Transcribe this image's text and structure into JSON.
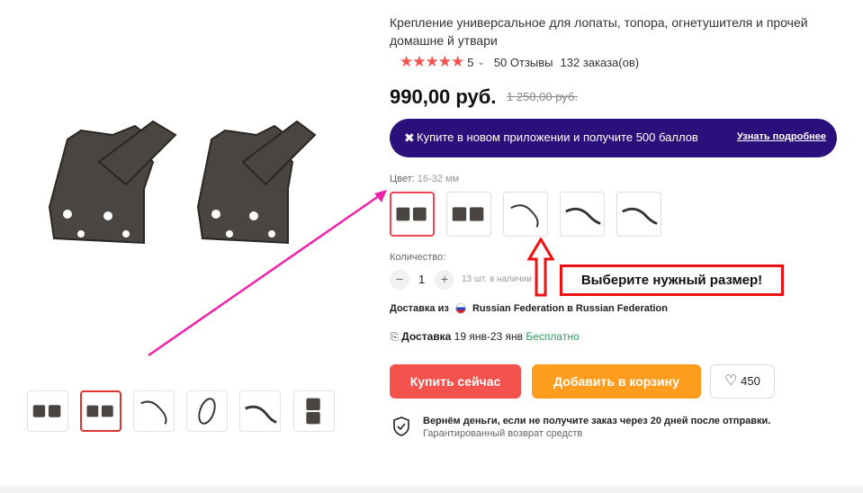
{
  "product": {
    "title": "Крепление универсальное для лопаты, топора, огнетушителя и прочей домашне й утвари",
    "rating": "5",
    "reviews": "50 Отзывы",
    "orders": "132 заказа(ов)",
    "price": "990,00 руб.",
    "old_price": "1 250,00 руб."
  },
  "promo": {
    "text": "Купите в новом приложении и получите 500 баллов",
    "link": "Узнать подробнее",
    "bg_color": "#2b0f7a"
  },
  "variant": {
    "label": "Цвет:",
    "selected": "16-32 мм",
    "count": 5
  },
  "quantity": {
    "label": "Количество:",
    "value": "1",
    "minus": "−",
    "plus": "+",
    "stock": "13 шт. в наличии"
  },
  "callout": {
    "text": "Выберите нужный размер!",
    "color": "#ee1111"
  },
  "shipping": {
    "from_label": "Доставка из",
    "from_text": "Russian Federation в Russian Federation",
    "delivery_label": "Доставка",
    "dates": "19 янв-23 янв",
    "cost": "Бесплатно"
  },
  "buttons": {
    "buy_now": "Купить сейчас",
    "add_to_cart": "Добавить в корзину",
    "wishlist_count": "450",
    "buy_color": "#f4524d",
    "cart_color": "#fd9c1d"
  },
  "guarantee": {
    "title": "Вернём деньги, если не получите заказ через 20 дней после отправки.",
    "subtitle": "Гарантированный возврат средств"
  },
  "annotation": {
    "arrow_color": "#ee22aa"
  }
}
